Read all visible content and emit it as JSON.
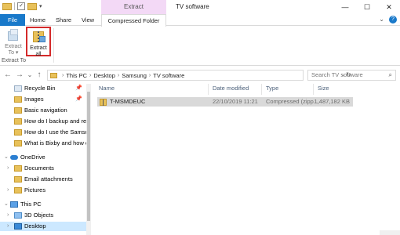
{
  "window": {
    "title": "TV software",
    "context_header": "Extract",
    "minimize": "—",
    "maximize": "☐",
    "close": "✕"
  },
  "ribbon_tabs": {
    "file": "File",
    "home": "Home",
    "share": "Share",
    "view": "View",
    "compressed": "Compressed Folder Tools",
    "expand_glyph": "⌄",
    "help_glyph": "?"
  },
  "ribbon": {
    "extract_to_line1": "Extract",
    "extract_to_line2": "To ▾",
    "extract_all_line1": "Extract",
    "extract_all_line2": "all",
    "group_label": "Extract To"
  },
  "nav": {
    "back": "←",
    "forward": "→",
    "recent": "⌄",
    "up": "↑"
  },
  "address": {
    "crumbs": [
      "This PC",
      "Desktop",
      "Samsung",
      "TV software"
    ],
    "separator": "›",
    "dropdown": "⌄",
    "refresh": "↻"
  },
  "search": {
    "placeholder": "Search TV software",
    "icon": "⌕"
  },
  "navpane": {
    "items": [
      {
        "label": "Recycle Bin",
        "pinned": true
      },
      {
        "label": "Images",
        "pinned": true
      },
      {
        "label": "Basic navigation"
      },
      {
        "label": "How do I backup and rest"
      },
      {
        "label": "How do I use the Samsun"
      },
      {
        "label": "What is Bixby and how do"
      },
      {
        "label": "OneDrive"
      },
      {
        "label": "Documents"
      },
      {
        "label": "Email attachments"
      },
      {
        "label": "Pictures"
      },
      {
        "label": "This PC"
      },
      {
        "label": "3D Objects"
      },
      {
        "label": "Desktop"
      }
    ],
    "pin_glyph": "📌"
  },
  "filelist": {
    "columns": {
      "name": "Name",
      "date": "Date modified",
      "type": "Type",
      "size": "Size"
    },
    "rows": [
      {
        "name": "T-MSMDEUC",
        "date": "22/10/2019 11:21",
        "type": "Compressed (zipp...",
        "size": "1,487,182 KB"
      }
    ]
  }
}
